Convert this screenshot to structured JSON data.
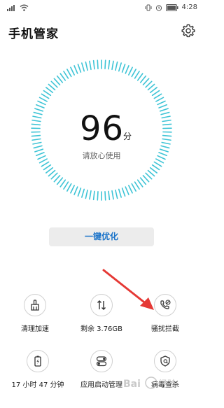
{
  "status_bar": {
    "time": "4:28",
    "battery_icon": "battery-icon",
    "alarm_icon": "alarm-icon",
    "signal_icon": "signal-icon",
    "wifi_icon": "wifi-icon"
  },
  "header": {
    "title": "手机管家",
    "settings_icon": "gear-icon"
  },
  "dial": {
    "score": "96",
    "unit": "分",
    "subtitle": "请放心使用",
    "accent": "#3ec4d6"
  },
  "optimize_button": {
    "label": "一键优化",
    "color": "#1a73c9"
  },
  "tools": [
    {
      "label": "清理加速",
      "icon": "broom-icon"
    },
    {
      "label": "剩余 3.76GB",
      "icon": "transfer-arrows-icon"
    },
    {
      "label": "骚扰拦截",
      "icon": "phone-block-icon"
    },
    {
      "label": "17 小时 47 分钟",
      "icon": "battery-icon"
    },
    {
      "label": "应用启动管理",
      "icon": "toggle-icon"
    },
    {
      "label": "病毒查杀",
      "icon": "shield-icon"
    }
  ],
  "annotation": {
    "arrow_color": "#e53935"
  },
  "watermark": {
    "text": "Bai 经验"
  }
}
